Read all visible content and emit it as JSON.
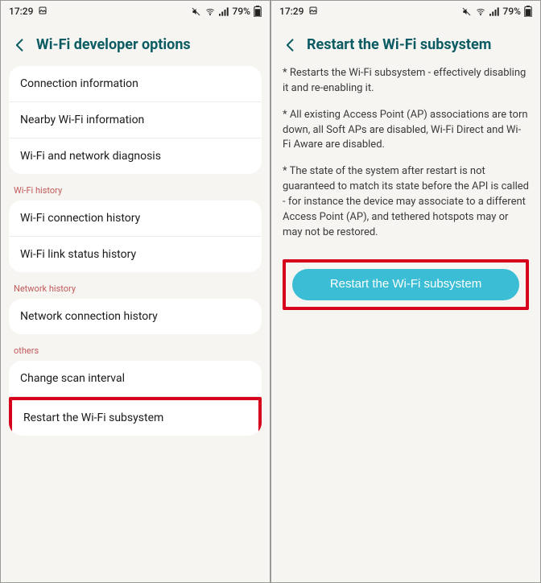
{
  "status": {
    "time": "17:29",
    "battery": "79%"
  },
  "left_screen": {
    "title": "Wi-Fi developer options",
    "group1": [
      "Connection information",
      "Nearby Wi-Fi information",
      "Wi-Fi and network diagnosis"
    ],
    "group2_label": "Wi-Fi history",
    "group2": [
      "Wi-Fi connection history",
      "Wi-Fi link status history"
    ],
    "group3_label": "Network history",
    "group3": [
      "Network connection history"
    ],
    "group4_label": "others",
    "group4": [
      "Change scan interval",
      "Restart the Wi-Fi subsystem"
    ]
  },
  "right_screen": {
    "title": "Restart the Wi-Fi subsystem",
    "paragraphs": [
      "* Restarts the Wi-Fi subsystem - effectively disabling it and re-enabling it.",
      "* All existing Access Point (AP) associations are torn down, all Soft APs are disabled, Wi-Fi Direct and Wi-Fi Aware are disabled.",
      "* The state of the system after restart is not guaranteed to match its state before the API is called - for instance the device may associate to a different Access Point (AP), and tethered hotspots may or may not be restored."
    ],
    "button": "Restart the Wi-Fi subsystem"
  }
}
